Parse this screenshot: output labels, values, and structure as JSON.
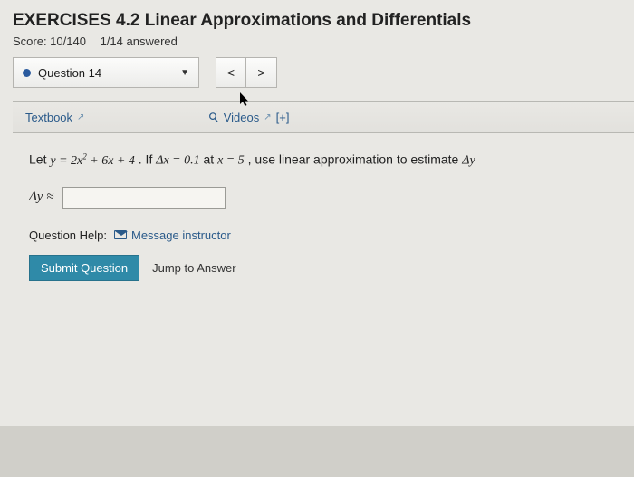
{
  "header": {
    "title": "EXERCISES 4.2 Linear Approximations and Differentials",
    "score_label": "Score: 10/140",
    "answered_label": "1/14 answered"
  },
  "question_selector": {
    "label": "Question 14",
    "prev_glyph": "<",
    "next_glyph": ">"
  },
  "resources": {
    "textbook_label": "Textbook",
    "videos_label": "Videos",
    "expand_label": "[+]"
  },
  "question": {
    "prompt_prefix": "Let ",
    "equation": "y = 2x² + 6x + 4",
    "if_text": ". If ",
    "delta_x_eq": "Δx = 0.1",
    "at_text": " at ",
    "x_eq": "x = 5",
    "use_text": ", use linear approximation to estimate ",
    "delta_y": "Δy",
    "answer_label": "Δy ≈",
    "answer_value": ""
  },
  "help": {
    "label": "Question Help:",
    "message_label": "Message instructor"
  },
  "actions": {
    "submit_label": "Submit Question",
    "jump_label": "Jump to Answer"
  }
}
